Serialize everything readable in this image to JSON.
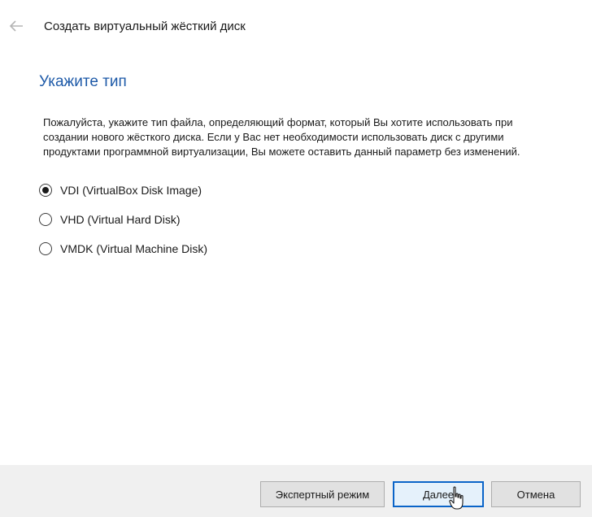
{
  "header": {
    "title": "Создать виртуальный жёсткий диск",
    "back_icon": "arrow-left-icon"
  },
  "main": {
    "section_title": "Укажите тип",
    "description": "Пожалуйста, укажите тип файла, определяющий формат, который Вы хотите использовать при создании нового жёсткого диска. Если у Вас нет необходимости использовать диск с другими продуктами программной виртуализации, Вы можете оставить данный параметр без изменений.",
    "options": [
      {
        "label": "VDI (VirtualBox Disk Image)",
        "selected": true
      },
      {
        "label": "VHD (Virtual Hard Disk)",
        "selected": false
      },
      {
        "label": "VMDK (Virtual Machine Disk)",
        "selected": false
      }
    ]
  },
  "footer": {
    "expert_label": "Экспертный режим",
    "next_label": "Далее",
    "cancel_label": "Отмена"
  },
  "colors": {
    "accent": "#1e5aa8",
    "primary_border": "#0a64c8",
    "footer_bg": "#f0f0f0"
  }
}
